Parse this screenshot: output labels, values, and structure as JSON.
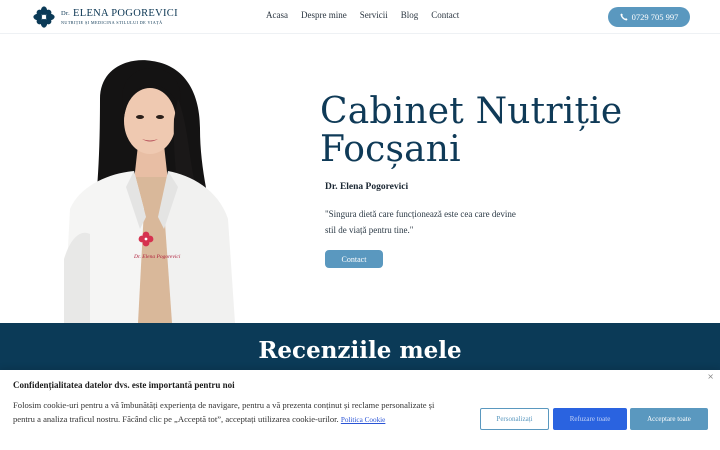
{
  "header": {
    "logo": {
      "prefix": "Dr.",
      "name": "ELENA POGOREVICI",
      "tagline": "NUTRIȚIE ȘI MEDICINA STILULUI DE VIAȚĂ"
    },
    "nav": [
      "Acasa",
      "Despre mine",
      "Servicii",
      "Blog",
      "Contact"
    ],
    "phone": "0729 705 997"
  },
  "hero": {
    "title_line1": "Cabinet Nutriție",
    "title_line2": "Focșani",
    "subtitle": "Dr. Elena Pogorevici",
    "quote": "\"Singura dietă care funcționează este cea care devine stil de viață pentru tine.\"",
    "button": "Contact",
    "coat_label": "Dr. Elena Pogorevici"
  },
  "reviews": {
    "title": "Recenziile mele"
  },
  "cookie": {
    "title": "Confidențialitatea datelor dvs. este importantă pentru noi",
    "text": "Folosim cookie-uri pentru a vă îmbunătăți experiența de navigare, pentru a vă prezenta conținut și reclame personalizate și pentru a analiza traficul nostru. Făcând clic pe „Acceptă tot”, acceptați utilizarea cookie-urilor.",
    "policy_link": "Politica Cookie",
    "close": "×",
    "buttons": {
      "customize": "Personalizați",
      "reject": "Refuzare toate",
      "accept": "Acceptare toate"
    }
  },
  "colors": {
    "brand_navy": "#0b3a57",
    "accent_blue": "#5a98bf",
    "reject_blue": "#2a63e0",
    "logo_pink": "#d6324f"
  },
  "icons": {
    "logo": "flower-logo-icon",
    "phone": "phone-icon",
    "close": "close-icon"
  }
}
